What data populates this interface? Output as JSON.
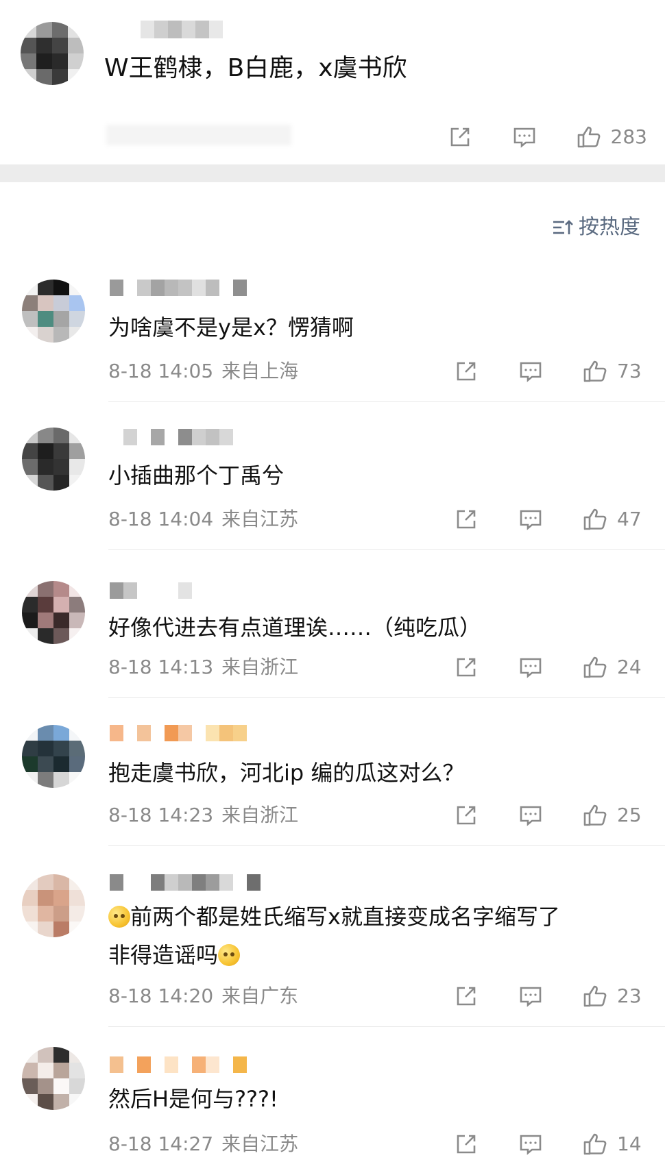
{
  "top_comment": {
    "text": "W王鹤棣，B白鹿，x虞书欣",
    "like_count": "283"
  },
  "sort": {
    "label": "按热度"
  },
  "comments": [
    {
      "text": "为啥虞不是y是x？愣猜啊",
      "time": "8-18 14:05",
      "location": "来自上海",
      "like_count": "73"
    },
    {
      "text": "小插曲那个丁禹兮",
      "time": "8-18 14:04",
      "location": "来自江苏",
      "like_count": "47"
    },
    {
      "text": "好像代进去有点道理诶……（纯吃瓜）",
      "time": "8-18 14:13",
      "location": "来自浙江",
      "like_count": "24"
    },
    {
      "text": "抱走虞书欣，河北ip 编的瓜这对么？",
      "time": "8-18 14:23",
      "location": "来自浙江",
      "like_count": "25"
    },
    {
      "text_line1": "前两个都是姓氏缩写x就直接变成名字缩写了",
      "text_line2": "非得造谣吗",
      "time": "8-18 14:20",
      "location": "来自广东",
      "like_count": "23"
    },
    {
      "text": "然后H是何与???!",
      "time": "8-18 14:27",
      "location": "来自江苏",
      "like_count": "14"
    }
  ],
  "icons": {
    "share": "share-icon",
    "reply": "comment-icon",
    "like": "thumbs-up-icon",
    "sort": "sort-icon"
  },
  "colors": {
    "meta_gray": "#8a8a8a",
    "sort_blue_gray": "#5a6a80",
    "separator": "#ececec"
  }
}
